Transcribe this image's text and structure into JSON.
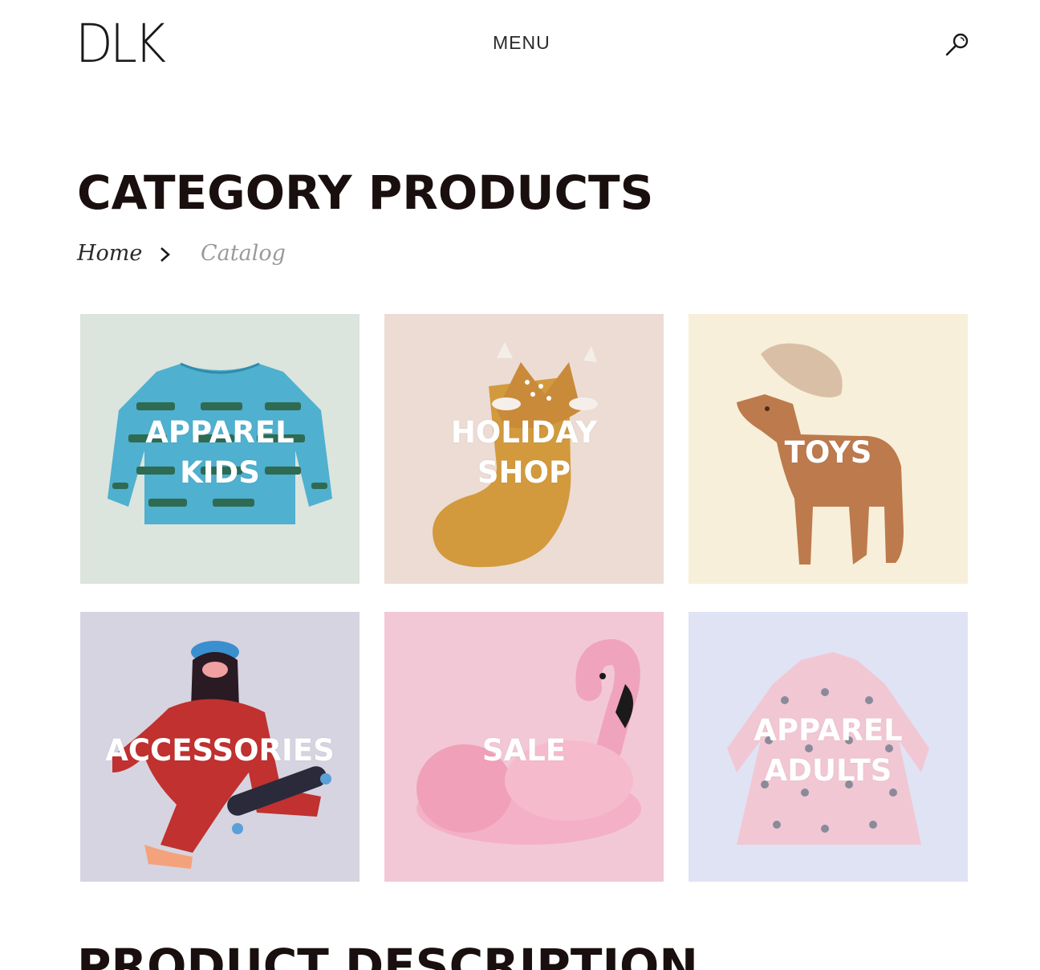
{
  "header": {
    "logo_text": "DLK",
    "menu_label": "MENU",
    "search_icon": "search-icon"
  },
  "page": {
    "title": "CATEGORY PRODUCTS",
    "section_title": "PRODUCT DESCRIPTION"
  },
  "breadcrumb": {
    "home": "Home",
    "separator_icon": "chevron-right-icon",
    "current": "Catalog"
  },
  "categories": [
    {
      "line1": "APPAREL",
      "line2": "KIDS",
      "bg": "#dbe4dd"
    },
    {
      "line1": "HOLIDAY",
      "line2": "SHOP",
      "bg": "#ecdcd4"
    },
    {
      "line1": "TOYS",
      "line2": "",
      "bg": "#f7efd9"
    },
    {
      "line1": "ACCESSORIES",
      "line2": "",
      "bg": "#d6d4e0"
    },
    {
      "line1": "SALE",
      "line2": "",
      "bg": "#f2c8d6"
    },
    {
      "line1": "APPAREL",
      "line2": "ADULTS",
      "bg": "#dfe3f4"
    }
  ]
}
